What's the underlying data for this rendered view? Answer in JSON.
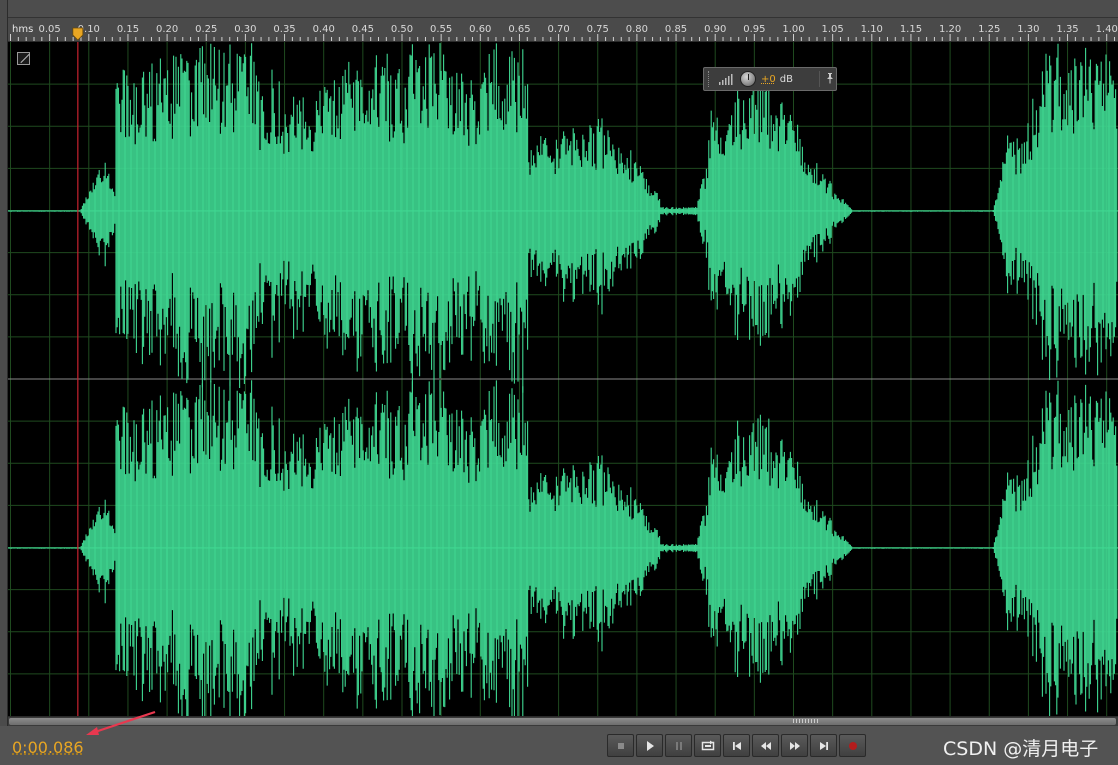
{
  "ruler": {
    "unit_label": "hms",
    "ticks": [
      "0.05",
      "0.10",
      "0.15",
      "0.20",
      "0.25",
      "0.30",
      "0.35",
      "0.40",
      "0.45",
      "0.50",
      "0.55",
      "0.60",
      "0.65",
      "0.70",
      "0.75",
      "0.80",
      "0.85",
      "0.90",
      "0.95",
      "1.00",
      "1.05",
      "1.10",
      "1.15",
      "1.20",
      "1.25",
      "1.30",
      "1.35",
      "1.40"
    ],
    "playhead_time": 0.086
  },
  "hud": {
    "volume_value": "+0",
    "volume_unit": "dB"
  },
  "status": {
    "current_time": "0:00.086"
  },
  "transport": [
    {
      "name": "stop-button",
      "icon": "stop-icon"
    },
    {
      "name": "play-button",
      "icon": "play-icon"
    },
    {
      "name": "pause-button",
      "icon": "pause-icon"
    },
    {
      "name": "loop-button",
      "icon": "loop-icon"
    },
    {
      "name": "go-to-start-button",
      "icon": "skip-start-icon"
    },
    {
      "name": "rewind-button",
      "icon": "rewind-icon"
    },
    {
      "name": "fast-forward-button",
      "icon": "fast-forward-icon"
    },
    {
      "name": "go-to-end-button",
      "icon": "skip-end-icon"
    },
    {
      "name": "record-button",
      "icon": "record-icon"
    }
  ],
  "watermark": "CSDN @清月电子",
  "colors": {
    "waveform": "#3fd892",
    "background": "#000000",
    "grid": "#1f4a1f",
    "playhead": "#c8232f",
    "time_text": "#e8a623",
    "arrow": "#e8384f"
  }
}
